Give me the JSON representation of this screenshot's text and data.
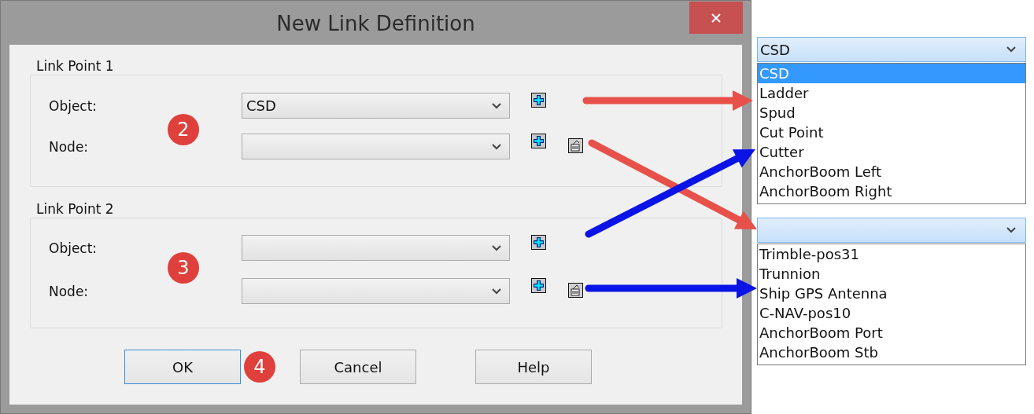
{
  "window": {
    "title": "New Link Definition"
  },
  "groups": [
    {
      "title": "Link Point 1",
      "rows": [
        {
          "label": "Object:",
          "value": "CSD",
          "actions": [
            {
              "kind": "add"
            }
          ]
        },
        {
          "label": "Node:",
          "actions": [
            {
              "kind": "add"
            },
            {
              "kind": "edit"
            }
          ]
        }
      ]
    },
    {
      "title": "Link Point 2",
      "rows": [
        {
          "label": "Object:",
          "actions": [
            {
              "kind": "add"
            }
          ]
        },
        {
          "label": "Node:",
          "actions": [
            {
              "kind": "add"
            },
            {
              "kind": "edit"
            }
          ]
        }
      ]
    }
  ],
  "buttons": [
    {
      "label": "OK",
      "default": true
    },
    {
      "label": "Cancel",
      "default": false
    },
    {
      "label": "Help",
      "default": false
    }
  ],
  "markers": [
    "2",
    "3",
    "4"
  ],
  "dropdowns": [
    {
      "value": "CSD",
      "items": [
        {
          "label": "CSD",
          "selected": true
        },
        {
          "label": "Ladder",
          "selected": false
        },
        {
          "label": "Spud",
          "selected": false
        },
        {
          "label": "Cut Point",
          "selected": false
        },
        {
          "label": "Cutter",
          "selected": false
        },
        {
          "label": "AnchorBoom Left",
          "selected": false
        },
        {
          "label": "AnchorBoom Right",
          "selected": false
        }
      ]
    },
    {
      "items": [
        {
          "label": "Trimble-pos31",
          "selected": false
        },
        {
          "label": "Trunnion",
          "selected": false
        },
        {
          "label": "Ship GPS Antenna",
          "selected": false
        },
        {
          "label": "C-NAV-pos10",
          "selected": false
        },
        {
          "label": "AnchorBoom Port",
          "selected": false
        },
        {
          "label": "AnchorBoom Stb",
          "selected": false
        }
      ]
    }
  ],
  "arrows": [
    {
      "color": "#e8504a"
    },
    {
      "color": "#e8504a"
    },
    {
      "color": "#0a14e6"
    },
    {
      "color": "#0a14e6"
    }
  ]
}
